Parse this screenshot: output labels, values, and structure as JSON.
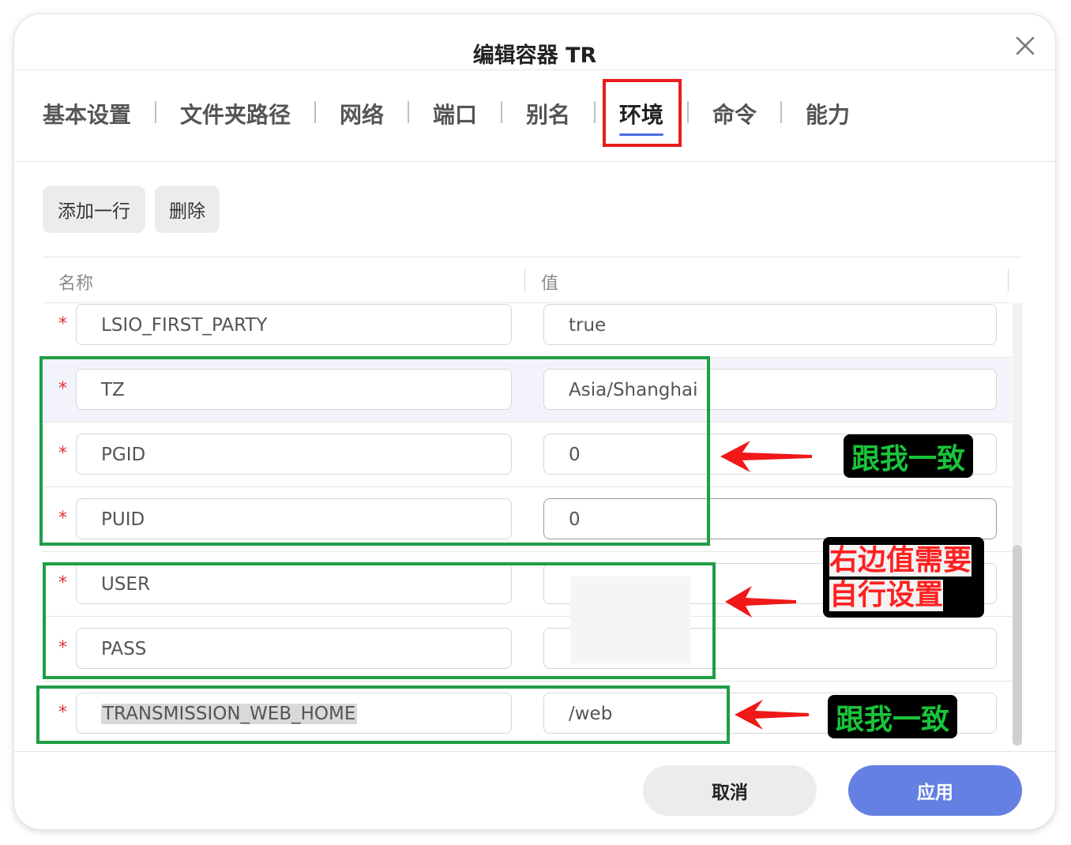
{
  "dialog": {
    "title": "编辑容器 TR"
  },
  "tabs": [
    {
      "label": "基本设置"
    },
    {
      "label": "文件夹路径"
    },
    {
      "label": "网络"
    },
    {
      "label": "端口"
    },
    {
      "label": "别名"
    },
    {
      "label": "环境",
      "active": true
    },
    {
      "label": "命令"
    },
    {
      "label": "能力"
    }
  ],
  "toolbar": {
    "add_row": "添加一行",
    "delete": "删除"
  },
  "table": {
    "headers": {
      "name": "名称",
      "value": "值"
    },
    "required_mark": "*",
    "rows": [
      {
        "name": "LSIO_FIRST_PARTY",
        "value": "true"
      },
      {
        "name": "TZ",
        "value": "Asia/Shanghai"
      },
      {
        "name": "PGID",
        "value": "0"
      },
      {
        "name": "PUID",
        "value": "0"
      },
      {
        "name": "USER",
        "value": ""
      },
      {
        "name": "PASS",
        "value": ""
      },
      {
        "name": "TRANSMISSION_WEB_HOME",
        "value": "/web"
      }
    ]
  },
  "annotations": {
    "same_1": "跟我一致",
    "set_line1": "右边值需要",
    "set_line2": "自行设置",
    "same_2": "跟我一致"
  },
  "footer": {
    "cancel": "取消",
    "apply": "应用"
  },
  "colors": {
    "accent": "#6480e2",
    "annotation_green": "#1e9e46",
    "annotation_red": "#e81c1c",
    "required": "#e03131"
  }
}
